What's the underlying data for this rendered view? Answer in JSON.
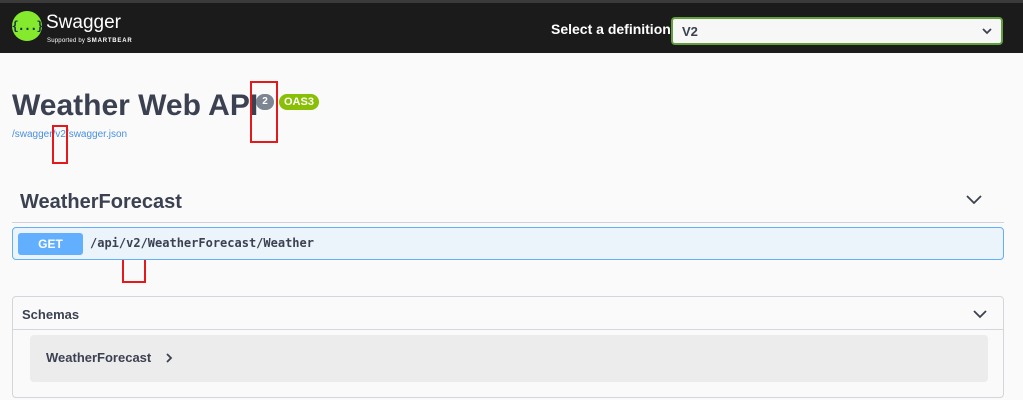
{
  "topbar": {
    "logo_glyph": "{...}",
    "brand": "Swagger",
    "brand_sub_prefix": "Supported by ",
    "brand_sub_company": "SMARTBEAR",
    "definition_label": "Select a definition",
    "definition_value": "V2"
  },
  "info": {
    "title": "Weather Web API",
    "version": "2",
    "oas_badge": "OAS3",
    "spec_url": "/swagger/v2/swagger.json"
  },
  "tag": {
    "name": "WeatherForecast"
  },
  "operation": {
    "method": "GET",
    "path": "/api/v2/WeatherForecast/Weather"
  },
  "schemas": {
    "title": "Schemas",
    "models": [
      "WeatherForecast"
    ]
  },
  "colors": {
    "topbar_bg": "#1b1b1b",
    "logo_green": "#85ea2d",
    "select_border": "#62a03f",
    "version_badge": "#7d8492",
    "oas_badge": "#89bf04",
    "get_method": "#61affe",
    "get_bg": "#ebf3fb",
    "annotation_red": "#e3191c"
  }
}
